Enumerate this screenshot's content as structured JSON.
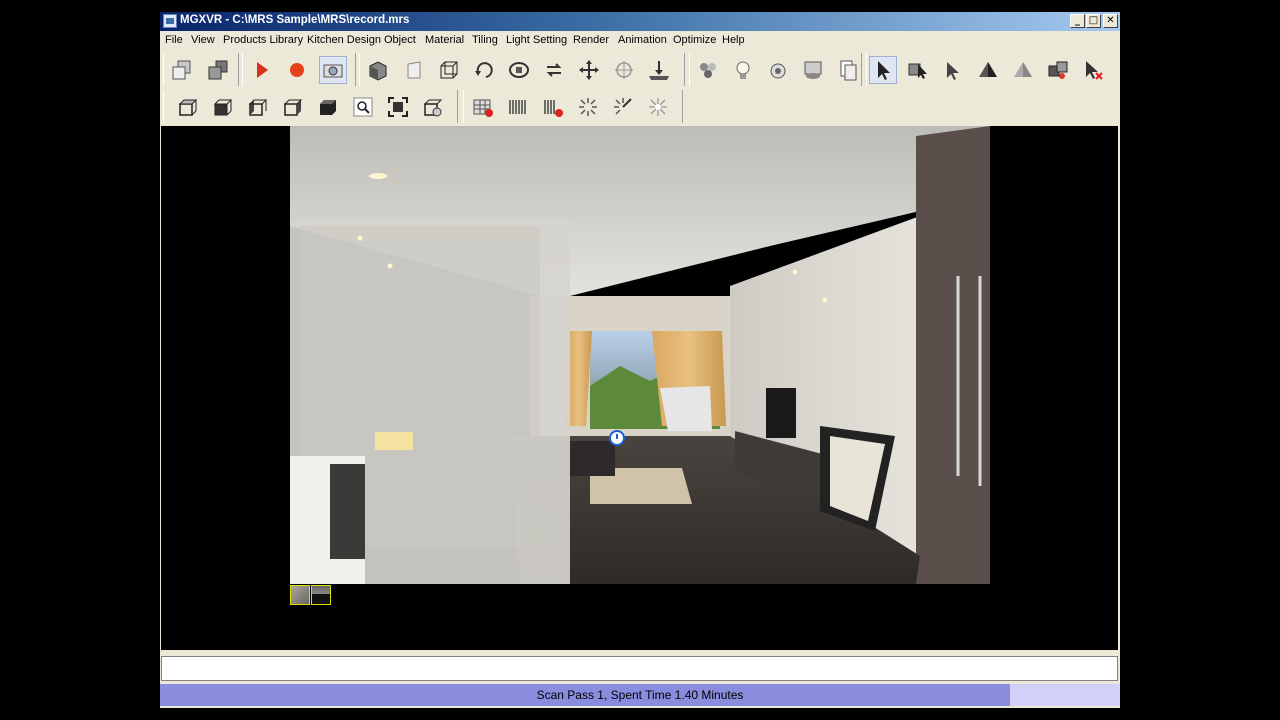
{
  "window": {
    "title": "MGXVR - C:\\MRS Sample\\MRS\\record.mrs",
    "controls": {
      "minimize": "_",
      "maximize": "□",
      "close": "✕"
    }
  },
  "menu": [
    "File",
    "View",
    "Products Library",
    "Kitchen Design",
    "Object",
    "Material",
    "Tiling",
    "Light Setting",
    "Render",
    "Animation",
    "Optimize",
    "Help"
  ],
  "toolbar1": [
    "copy-boxes-icon",
    "gray-box-icon",
    "play-icon",
    "record-icon",
    "camera-icon",
    "cube-shaded-icon",
    "panel-icon",
    "wireframe-cube-icon",
    "rotate-icon",
    "orbit-icon",
    "refresh-icon",
    "move-icon",
    "target-icon",
    "ground-icon",
    "spheres-icon",
    "light-bulb-icon",
    "spotlight-icon",
    "monitor-eye-icon",
    "display-icon",
    "pages-icon",
    "select-arrow-icon",
    "select-box-icon",
    "select-cursor-icon",
    "pyramid-dark-icon",
    "pyramid-light-icon",
    "multi-box-icon",
    "delete-cursor-icon"
  ],
  "toolbar2": [
    "view-top-icon",
    "view-front-icon",
    "view-left-icon",
    "view-right-icon",
    "view-perspective-icon",
    "zoom-icon",
    "zoom-extents-icon",
    "view-options-icon",
    "grid-delete-icon",
    "barcode-icon",
    "barcode-delete-icon",
    "sunburst-icon",
    "sunburst-arrow-icon",
    "sparkle-icon"
  ],
  "viewport": {
    "thumbnails": [
      "render-thumbnail-1",
      "render-thumbnail-2"
    ]
  },
  "cmdline": {
    "value": ""
  },
  "status": {
    "text": "Scan Pass 1, Spent Time 1.40 Minutes",
    "progress": 0.885,
    "fill_color": "#8a8cde",
    "track_color": "#d0d0f8"
  }
}
